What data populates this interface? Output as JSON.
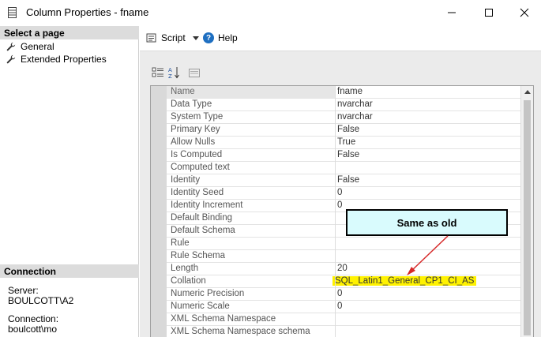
{
  "window": {
    "title": "Column Properties - fname"
  },
  "left_panel": {
    "select_page_header": "Select a page",
    "pages": [
      {
        "label": "General"
      },
      {
        "label": "Extended Properties"
      }
    ],
    "connection_header": "Connection",
    "server_label": "Server:",
    "server_value": "BOULCOTT\\A2",
    "connection_label": "Connection:",
    "connection_value": "boulcott\\mo"
  },
  "toolbar": {
    "script_label": "Script",
    "help_label": "Help"
  },
  "properties": [
    {
      "name": "Name",
      "value": "fname"
    },
    {
      "name": "Data Type",
      "value": "nvarchar"
    },
    {
      "name": "System Type",
      "value": "nvarchar"
    },
    {
      "name": "Primary Key",
      "value": "False"
    },
    {
      "name": "Allow Nulls",
      "value": "True"
    },
    {
      "name": "Is Computed",
      "value": "False"
    },
    {
      "name": "Computed text",
      "value": ""
    },
    {
      "name": "Identity",
      "value": "False"
    },
    {
      "name": "Identity Seed",
      "value": "0"
    },
    {
      "name": "Identity Increment",
      "value": "0"
    },
    {
      "name": "Default Binding",
      "value": ""
    },
    {
      "name": "Default Schema",
      "value": ""
    },
    {
      "name": "Rule",
      "value": ""
    },
    {
      "name": "Rule Schema",
      "value": ""
    },
    {
      "name": "Length",
      "value": "20"
    },
    {
      "name": "Collation",
      "value": "SQL_Latin1_General_CP1_CI_AS"
    },
    {
      "name": "Numeric Precision",
      "value": "0"
    },
    {
      "name": "Numeric Scale",
      "value": "0"
    },
    {
      "name": "XML Schema Namespace",
      "value": ""
    },
    {
      "name": "XML Schema Namespace schema",
      "value": ""
    }
  ],
  "annotation": {
    "text": "Same as old"
  },
  "colors": {
    "highlight": "#fff200",
    "callout_bg": "#d9fbfd",
    "arrow": "#d62828"
  }
}
